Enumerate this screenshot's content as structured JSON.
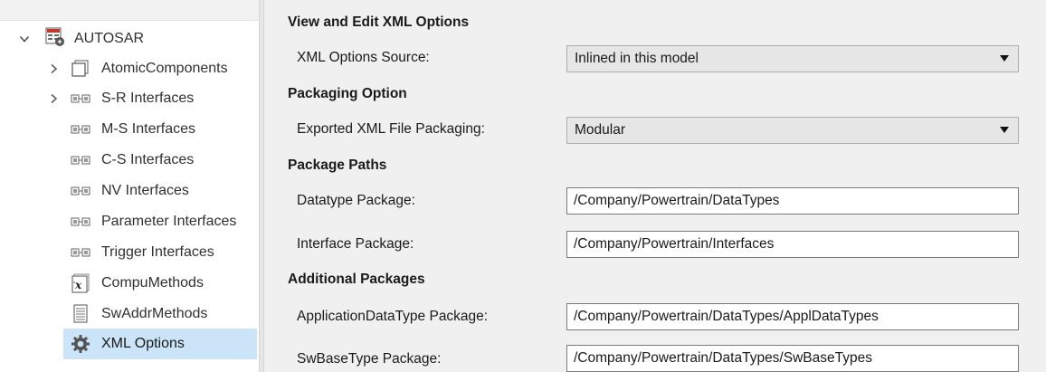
{
  "tree": {
    "root": {
      "label": "AUTOSAR",
      "icon": "autosar-dictionary-icon",
      "expanded": true
    },
    "items": [
      {
        "label": "AtomicComponents",
        "icon": "component-box-icon",
        "expandable": true
      },
      {
        "label": "S-R Interfaces",
        "icon": "interface-icon",
        "expandable": true
      },
      {
        "label": "M-S Interfaces",
        "icon": "interface-icon",
        "expandable": false
      },
      {
        "label": "C-S Interfaces",
        "icon": "interface-icon",
        "expandable": false
      },
      {
        "label": "NV Interfaces",
        "icon": "interface-icon",
        "expandable": false
      },
      {
        "label": "Parameter Interfaces",
        "icon": "interface-icon",
        "expandable": false
      },
      {
        "label": "Trigger Interfaces",
        "icon": "interface-icon",
        "expandable": false
      },
      {
        "label": "CompuMethods",
        "icon": "compu-method-icon",
        "expandable": false
      },
      {
        "label": "SwAddrMethods",
        "icon": "document-icon",
        "expandable": false
      },
      {
        "label": "XML Options",
        "icon": "gear-icon",
        "expandable": false,
        "selected": true
      }
    ]
  },
  "options": {
    "view_edit": {
      "heading": "View and Edit XML Options",
      "source_label": "XML Options Source:",
      "source_value": "Inlined in this model"
    },
    "packaging": {
      "heading": "Packaging Option",
      "label": "Exported XML File Packaging:",
      "value": "Modular"
    },
    "package_paths": {
      "heading": "Package Paths",
      "datatype_label": "Datatype Package:",
      "datatype_value": "/Company/Powertrain/DataTypes",
      "interface_label": "Interface Package:",
      "interface_value": "/Company/Powertrain/Interfaces"
    },
    "additional": {
      "heading": "Additional Packages",
      "appl_label": "ApplicationDataType Package:",
      "appl_value": "/Company/Powertrain/DataTypes/ApplDataTypes",
      "swbase_label": "SwBaseType Package:",
      "swbase_value": "/Company/Powertrain/DataTypes/SwBaseTypes"
    }
  },
  "colors": {
    "selection": "#cce4f7",
    "panel_bg": "#f0f0f0",
    "dropdown_bg": "#e6e6e6"
  }
}
